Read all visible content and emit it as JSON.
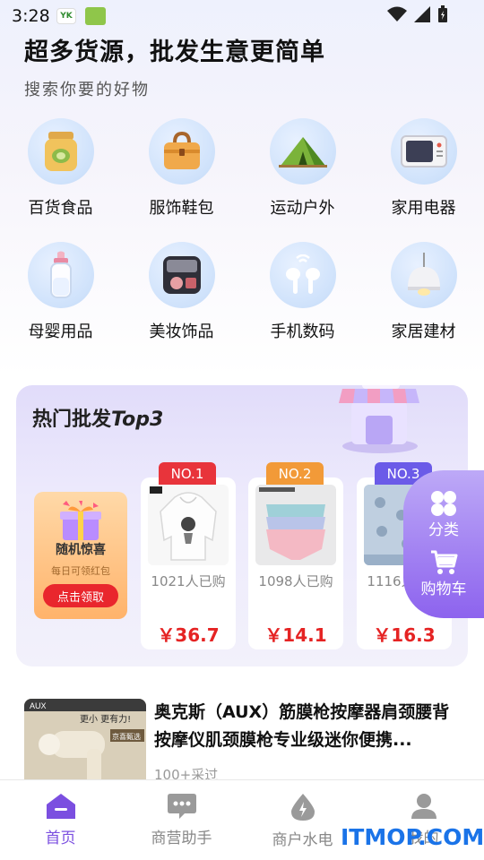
{
  "status_bar": {
    "time": "3:28",
    "app_icon1_text": "YK"
  },
  "header": {
    "title": "超多货源，批发生意更简单",
    "subtitle": "搜索你要的好物"
  },
  "categories": [
    {
      "label": "百货食品",
      "icon": "snack-jar-icon"
    },
    {
      "label": "服饰鞋包",
      "icon": "handbag-icon"
    },
    {
      "label": "运动户外",
      "icon": "tent-icon"
    },
    {
      "label": "家用电器",
      "icon": "microwave-icon"
    },
    {
      "label": "母婴用品",
      "icon": "baby-bottle-icon"
    },
    {
      "label": "美妆饰品",
      "icon": "eyeshadow-icon"
    },
    {
      "label": "手机数码",
      "icon": "earbuds-icon"
    },
    {
      "label": "家居建材",
      "icon": "pendant-lamp-icon"
    }
  ],
  "hot": {
    "title_prefix": "热门批发",
    "title_suffix": "Top3",
    "gift": {
      "title": "随机惊喜",
      "subtitle": "每日可领红包",
      "button": "点击领取"
    },
    "products": [
      {
        "rank": "NO.1",
        "rank_color": "#e8343b",
        "sold": "1021人已购",
        "price": "￥36.7"
      },
      {
        "rank": "NO.2",
        "rank_color": "#f29a38",
        "sold": "1098人已购",
        "price": "￥14.1"
      },
      {
        "rank": "NO.3",
        "rank_color": "#6b5be8",
        "sold": "1116人已购",
        "price": "￥16.3"
      }
    ]
  },
  "floating": {
    "category_label": "分类",
    "cart_label": "购物车"
  },
  "product_row": {
    "title": "奥克斯（AUX）筋膜枪按摩器肩颈腰背按摩仪肌颈膜枪专业级迷你便携...",
    "sold": "100+采过",
    "img_brand": "AUX",
    "img_text1": "更小 更有力!",
    "img_text2": "京喜甄选"
  },
  "tabs": [
    {
      "label": "首页",
      "icon": "home-icon",
      "active": true
    },
    {
      "label": "商营助手",
      "icon": "chat-bubble-icon",
      "active": false
    },
    {
      "label": "商户水电",
      "icon": "water-drop-icon",
      "active": false
    },
    {
      "label": "我的",
      "icon": "user-icon",
      "active": false
    }
  ],
  "watermark": "ITMOP.COM",
  "colors": {
    "accent": "#7b4fe0",
    "price": "#e52323",
    "gift_button": "#e9262d"
  }
}
